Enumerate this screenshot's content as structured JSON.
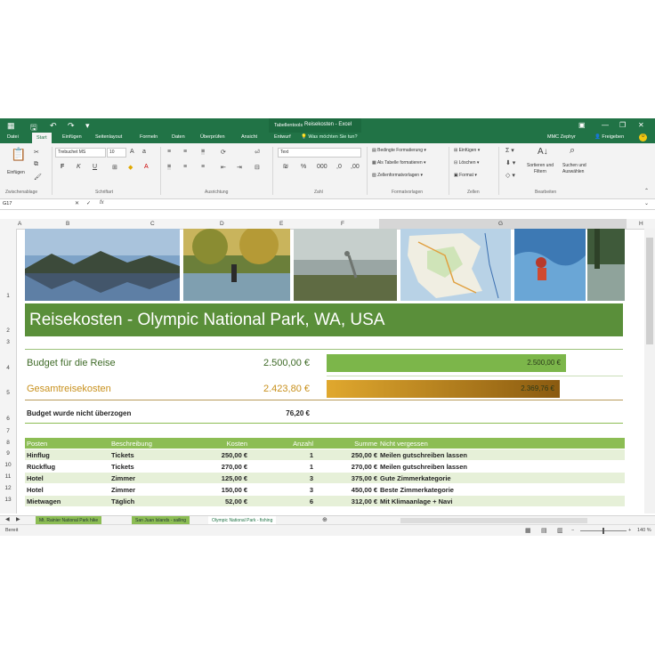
{
  "titlebar": {
    "contextual_tab": "Tabellentools",
    "title": "Reisekosten - Excel"
  },
  "tabs": {
    "items": [
      "Datei",
      "Start",
      "Einfügen",
      "Seitenlayout",
      "Formeln",
      "Daten",
      "Überprüfen",
      "Ansicht",
      "Entwurf"
    ],
    "tell_me": "Was möchten Sie tun?",
    "user": "MMC Zephyr",
    "share": "Freigeben"
  },
  "ribbon": {
    "paste": "Einfügen",
    "font_name": "Trebuchet MS",
    "font_size": "10",
    "number_format": "Text",
    "groups": [
      "Zwischenablage",
      "Schriftart",
      "Ausrichtung",
      "Zahl",
      "Formatvorlagen",
      "Zellen",
      "Bearbeiten"
    ],
    "styles": [
      "Bedingte Formatierung",
      "Als Tabelle formatieren",
      "Zellenformatvorlagen"
    ],
    "cells": [
      "Einfügen",
      "Löschen",
      "Format"
    ],
    "sort": [
      "Sortieren und",
      "Filtern"
    ],
    "find": [
      "Suchen und",
      "Auswählen"
    ]
  },
  "formula_bar": {
    "cell_ref": "G17",
    "fx": "fx"
  },
  "columns": [
    "A",
    "B",
    "C",
    "D",
    "E",
    "F",
    "G",
    "H"
  ],
  "rows": [
    "1",
    "2",
    "3",
    "4",
    "5",
    "6",
    "7",
    "8",
    "9",
    "10",
    "11",
    "12",
    "13"
  ],
  "sheet": {
    "title": "Reisekosten - Olympic National Park, WA, USA",
    "budget_label": "Budget für die Reise",
    "budget_value": "2.500,00 €",
    "budget_bar": "2.500,00 €",
    "total_label": "Gesamtreisekosten",
    "total_value": "2.423,80 €",
    "total_bar": "2.369,76 €",
    "status_label": "Budget wurde nicht überzogen",
    "status_value": "76,20 €",
    "table_headers": [
      "Posten",
      "Beschreibung",
      "Kosten",
      "Anzahl",
      "Summe",
      "Nicht vergessen"
    ],
    "table_rows": [
      [
        "Hinflug",
        "Tickets",
        "250,00 €",
        "1",
        "250,00 €",
        "Meilen gutschreiben lassen"
      ],
      [
        "Rückflug",
        "Tickets",
        "270,00 €",
        "1",
        "270,00 €",
        "Meilen gutschreiben lassen"
      ],
      [
        "Hotel",
        "Zimmer",
        "125,00 €",
        "3",
        "375,00 €",
        "Gute Zimmerkategorie"
      ],
      [
        "Hotel",
        "Zimmer",
        "150,00 €",
        "3",
        "450,00 €",
        "Beste Zimmerkategorie"
      ],
      [
        "Mietwagen",
        "Täglich",
        "52,00 €",
        "6",
        "312,00 €",
        "Mit Klimaanlage + Navi"
      ]
    ],
    "budget_fill": 1.0,
    "total_fill": 0.95
  },
  "sheet_tabs": [
    "Mt. Rainier National Park hike",
    "San Juan Islands - sailing",
    "Olympic National Park - fishing"
  ],
  "status": {
    "ready": "Bereit",
    "zoom": "140 %"
  },
  "colors": {
    "excel_green": "#217346",
    "banner_green": "#5a8f3a",
    "table_header": "#8cbd54",
    "row_band": "#e6f0d8",
    "budget_bar": "#7cb64a",
    "total_bar": "#d39a2a",
    "gold_text": "#c8901c",
    "green_text": "#3f6b28"
  }
}
